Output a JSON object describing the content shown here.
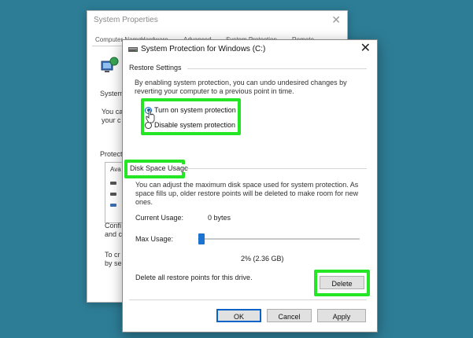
{
  "background_window": {
    "title": "System Properties",
    "close_glyph": "✕",
    "tabs": [
      "Computer Name",
      "Hardware",
      "Advanced",
      "System Protection",
      "Remote"
    ],
    "fragments": {
      "system": "System",
      "you_ca": "You ca",
      "your_c": "your c",
      "protection": "Protectio",
      "ava": "Ava",
      "confi": "Confi",
      "and_c": "and c",
      "to_cr": "To cr",
      "by_se": "by se"
    }
  },
  "dialog": {
    "title": "System Protection for Windows (C:)",
    "close_glyph": "✕",
    "restore_settings": {
      "label": "Restore Settings",
      "description_line1": "By enabling system protection, you can undo undesired changes by",
      "description_line2": "reverting your computer to a previous point in time.",
      "radio_on": "Turn on system protection",
      "radio_off": "Disable system protection",
      "selected": "on"
    },
    "disk_space": {
      "label": "Disk Space Usage",
      "description_line1": "You can adjust the maximum disk space used for system protection. As",
      "description_line2": "space fills up, older restore points will be deleted to make room for new",
      "description_line3": "ones.",
      "current_usage_label": "Current Usage:",
      "current_usage_value": "0 bytes",
      "max_usage_label": "Max Usage:",
      "max_usage_value": "2% (2.36 GB)",
      "max_usage_percent": 2,
      "delete_text": "Delete all restore points for this drive.",
      "delete_button": "Delete"
    },
    "buttons": {
      "ok": "OK",
      "cancel": "Cancel",
      "apply": "Apply"
    }
  },
  "colors": {
    "background": "#2d7d96",
    "highlight": "#25e625",
    "accent": "#0a64c8"
  }
}
